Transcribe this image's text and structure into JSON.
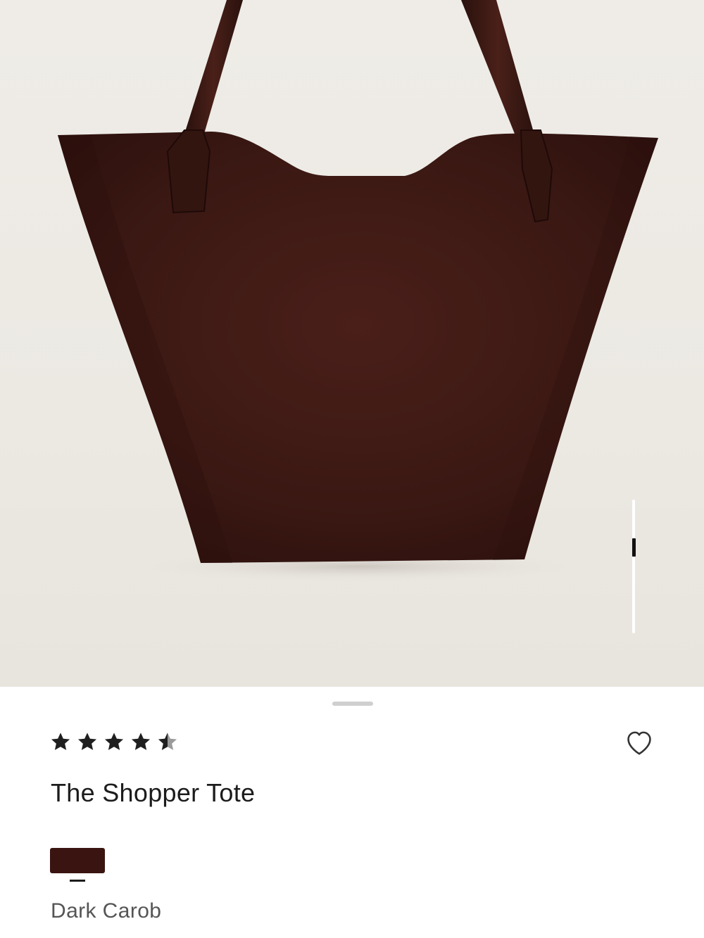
{
  "product": {
    "image_alt": "The Shopper Tote in Dark Carob suede",
    "image_count": 1,
    "rating": 4.5,
    "rating_max": 5,
    "title": "The Shopper Tote",
    "selected_color": "Dark Carob",
    "colors": [
      {
        "name": "Dark Carob",
        "hex": "#3a1410",
        "selected": true
      }
    ]
  },
  "theme": {
    "star_color": "#1f1f1f",
    "star_empty": "#9a9a9a",
    "bag_color": "#3d1914",
    "bag_shadow": "#2a0f0c",
    "strap_color": "#3a1a14",
    "heart_stroke": "#333333"
  }
}
